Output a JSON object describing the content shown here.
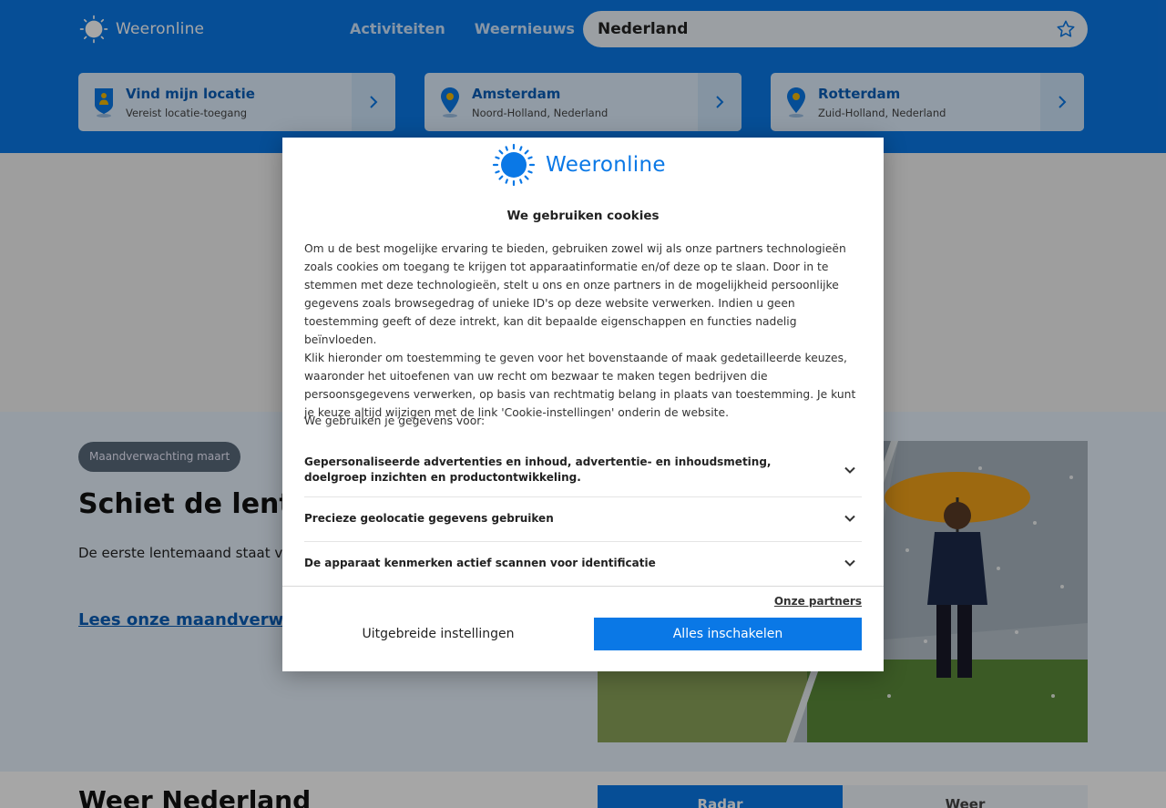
{
  "header": {
    "logo_text": "Weeronline",
    "nav": [
      "Activiteiten",
      "Weernieuws"
    ],
    "search": {
      "value": "Nederland"
    },
    "locations": [
      {
        "name": "Vind mijn locatie",
        "sub": "Vereist locatie-toegang"
      },
      {
        "name": "Amsterdam",
        "sub": "Noord-Holland, Nederland"
      },
      {
        "name": "Rotterdam",
        "sub": "Zuid-Holland, Nederland"
      }
    ]
  },
  "feature": {
    "tag": "Maandverwachting maart",
    "title": "Schiet de lente u",
    "text": "De eerste lentemaand staat voo opmaken voor lenteweer of krijg",
    "link": "Lees onze maandverwach"
  },
  "bottom": {
    "title": "Weer Nederland",
    "tabs": [
      "Radar",
      "Weer"
    ]
  },
  "modal": {
    "logo_text": "Weeronline",
    "title": "We gebruiken cookies",
    "body_1": "Om u de best mogelijke ervaring te bieden, gebruiken zowel wij als onze partners technologieën zoals cookies om toegang te krijgen tot apparaatinformatie en/of deze op te slaan. Door in te stemmen met deze technologieën, stelt u ons en onze partners in de mogelijkheid persoonlijke gegevens zoals browsegedrag of unieke ID's op deze website verwerken. Indien u geen toestemming geeft of deze intrekt, kan dit bepaalde eigenschappen en functies nadelig beïnvloeden.",
    "body_2": "Klik hieronder om toestemming te geven voor het bovenstaande of maak gedetailleerde keuzes, waaronder het uitoefenen van uw recht om bezwaar te maken tegen bedrijven die persoonsgegevens verwerken, op basis van rechtmatig belang in plaats van toestemming. Je kunt je keuze altijd wijzigen met de link 'Cookie-instellingen' onderin de website.",
    "uses_label": "We gebruiken je gegevens voor:",
    "purposes": [
      "Gepersonaliseerde advertenties en inhoud, advertentie- en inhoudsmeting, doelgroep inzichten en productontwikkeling.",
      "Precieze geolocatie gegevens gebruiken",
      "De apparaat kenmerken actief scannen voor identificatie"
    ],
    "partners_link": "Onze partners",
    "settings_button": "Uitgebreide instellingen",
    "accept_button": "Alles inschakelen"
  },
  "colors": {
    "brand_blue": "#0a78e6",
    "pin_yellow": "#f2b705"
  }
}
